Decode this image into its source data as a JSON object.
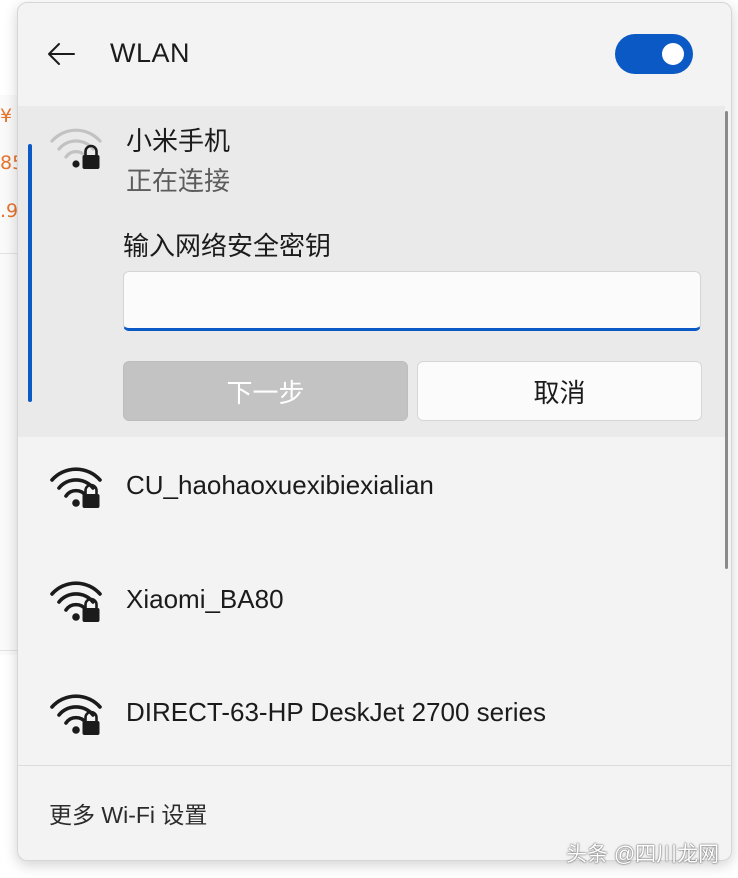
{
  "background": {
    "fragments": [
      "¥",
      "85",
      ".9"
    ]
  },
  "header": {
    "title": "WLAN",
    "wifi_enabled": true,
    "back_icon": "arrow-left-icon"
  },
  "connecting_network": {
    "name": "小米手机",
    "status": "正在连接",
    "signal_level": "low",
    "secured": true,
    "key_label": "输入网络安全密钥",
    "key_value": "",
    "next_label": "下一步",
    "cancel_label": "取消"
  },
  "networks": [
    {
      "name": "CU_haohaoxuexibiexialian",
      "signal_level": "full",
      "secured": true
    },
    {
      "name": "Xiaomi_BA80",
      "signal_level": "full",
      "secured": true
    },
    {
      "name": "DIRECT-63-HP DeskJet 2700 series",
      "signal_level": "full",
      "secured": true
    }
  ],
  "footer": {
    "more_settings_label": "更多 Wi-Fi 设置"
  },
  "watermark": "头条 @四川龙网"
}
